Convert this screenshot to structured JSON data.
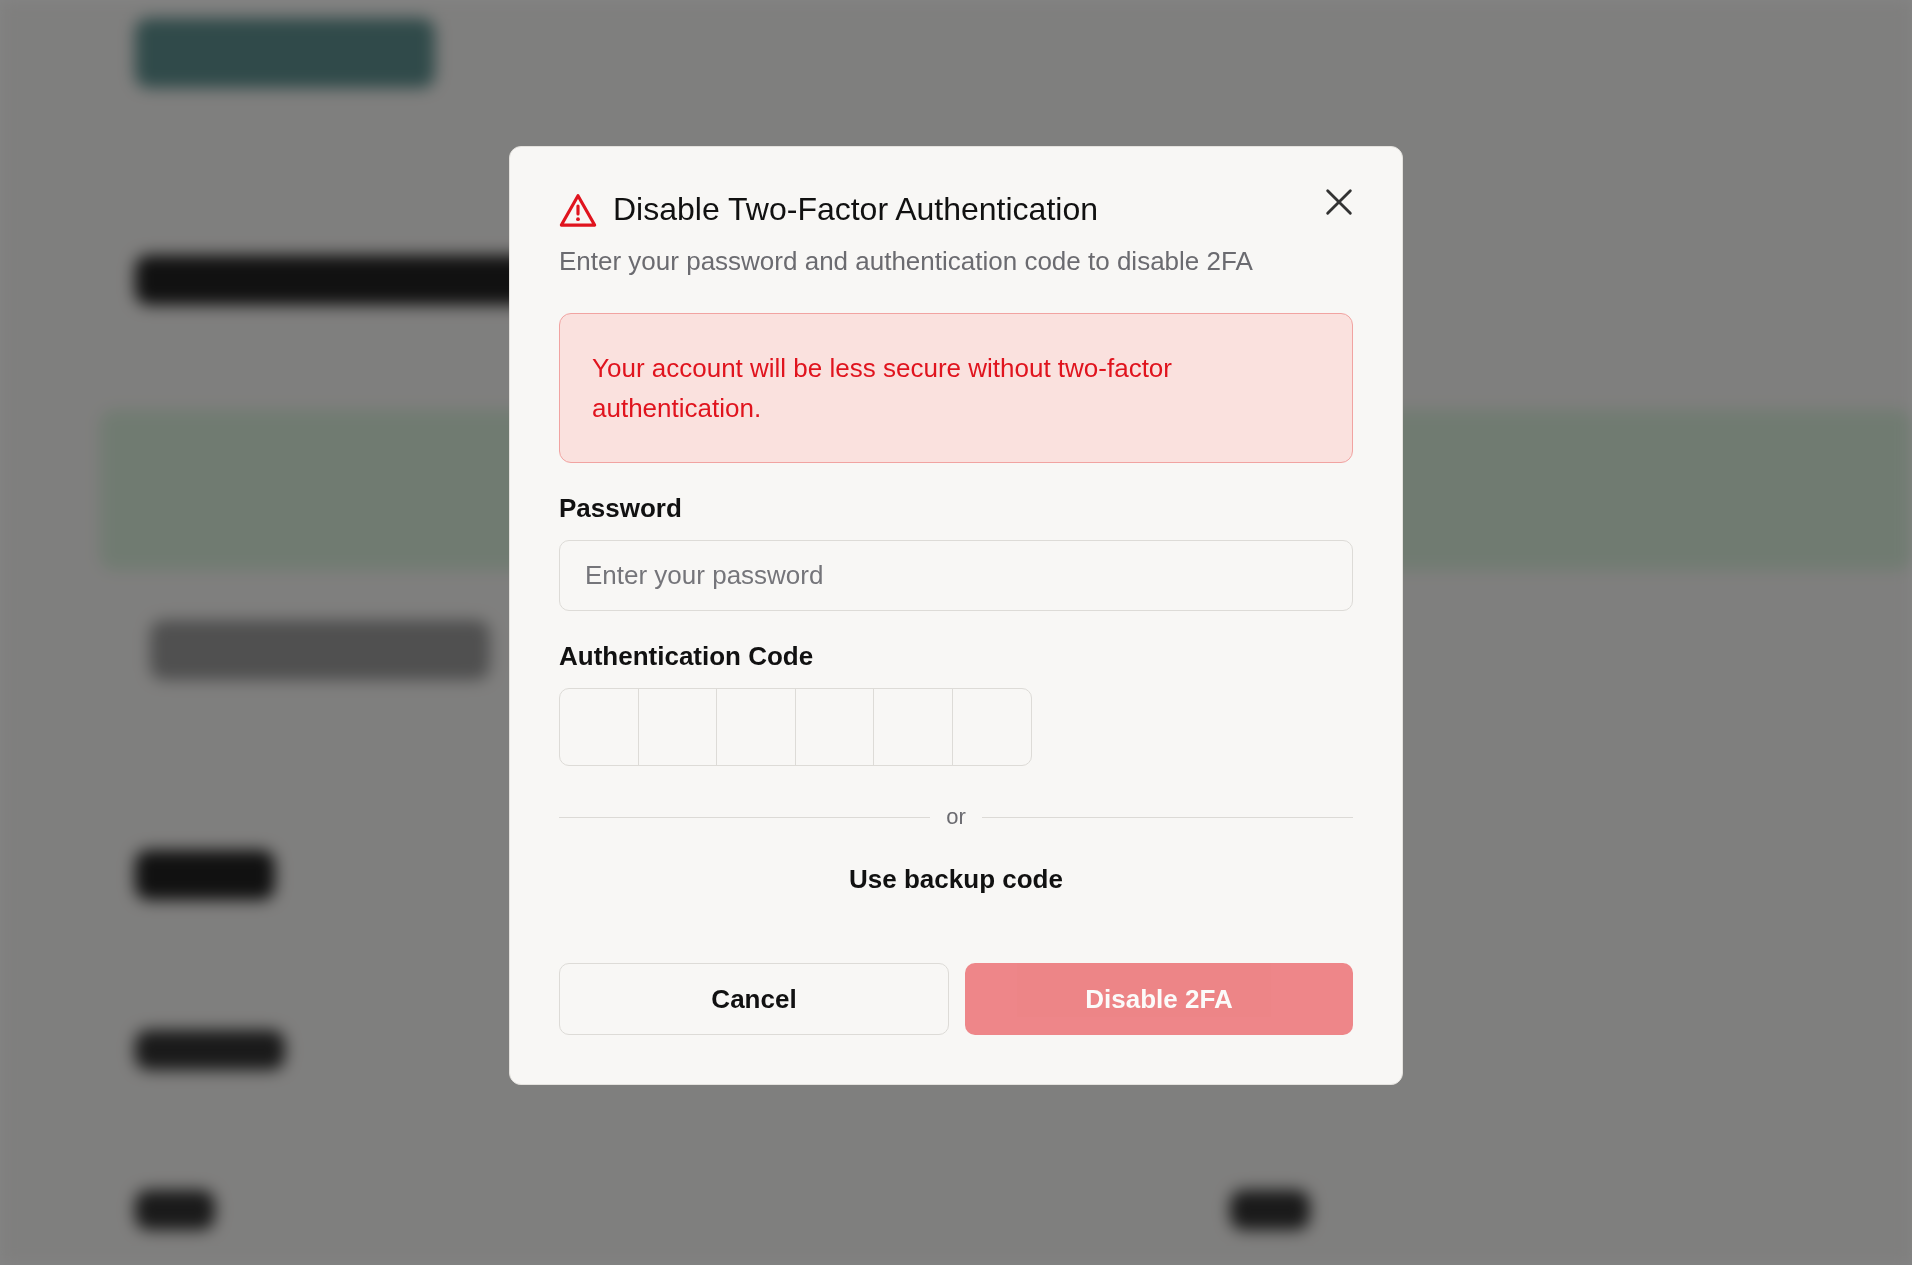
{
  "dialog": {
    "title": "Disable Two-Factor Authentication",
    "subtitle": "Enter your password and authentication code to disable 2FA",
    "warning": "Your account will be less secure without two-factor authentication.",
    "password": {
      "label": "Password",
      "placeholder": "Enter your password"
    },
    "code": {
      "label": "Authentication Code",
      "cells": [
        {
          "kind": "digit"
        },
        {
          "kind": "digit"
        },
        {
          "kind": "digit"
        },
        {
          "kind": "digit"
        },
        {
          "kind": "digit"
        },
        {
          "kind": "digit"
        }
      ]
    },
    "divider_text": "or",
    "backup_link": "Use backup code",
    "buttons": [
      {
        "label": "Cancel",
        "kind": "secondary",
        "disabled": false
      },
      {
        "label": "Disable 2FA",
        "kind": "danger",
        "disabled": true
      }
    ]
  }
}
